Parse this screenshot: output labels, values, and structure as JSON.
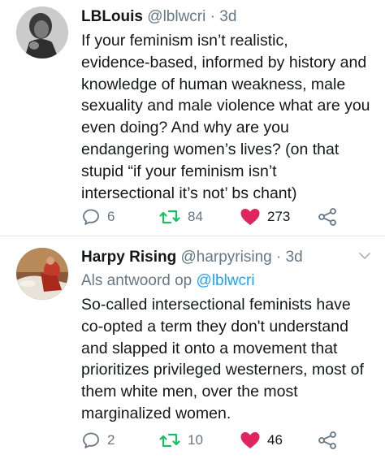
{
  "tweets": [
    {
      "display_name": "LBLouis",
      "handle": "@lblwcri",
      "time": "3d",
      "reply_prefix": "",
      "reply_mention": "",
      "lines": [
        "If your feminism isn’t realistic,",
        "evidence-based, informed by history and",
        "knowledge of human weakness, male",
        "sexuality and male violence what are you",
        "even doing? And why are you",
        "endangering women’s lives? (on that",
        "stupid “if your feminism isn’t",
        "intersectional it’s not’ bs chant)"
      ],
      "replies": "6",
      "retweets": "84",
      "likes": "273",
      "liked": true
    },
    {
      "display_name": "Harpy Rising",
      "handle": "@harpyrising",
      "time": "3d",
      "reply_prefix": "Als antwoord op",
      "reply_mention": "@lblwcri",
      "lines": [
        "So-called intersectional feminists have",
        "co-opted a term they don't understand",
        "and slapped it onto a movement that",
        "prioritizes privileged westerners, most of",
        "them white men, over the most",
        "marginalized women."
      ],
      "replies": "2",
      "retweets": "10",
      "likes": "46",
      "liked": true
    }
  ],
  "separator": "·",
  "colors": {
    "like": "#e0245e",
    "retweet": "#17bf63",
    "muted": "#657786",
    "link": "#1da1f2"
  },
  "icons": [
    "reply-icon",
    "retweet-icon",
    "heart-icon",
    "share-icon",
    "chevron-down-icon"
  ]
}
